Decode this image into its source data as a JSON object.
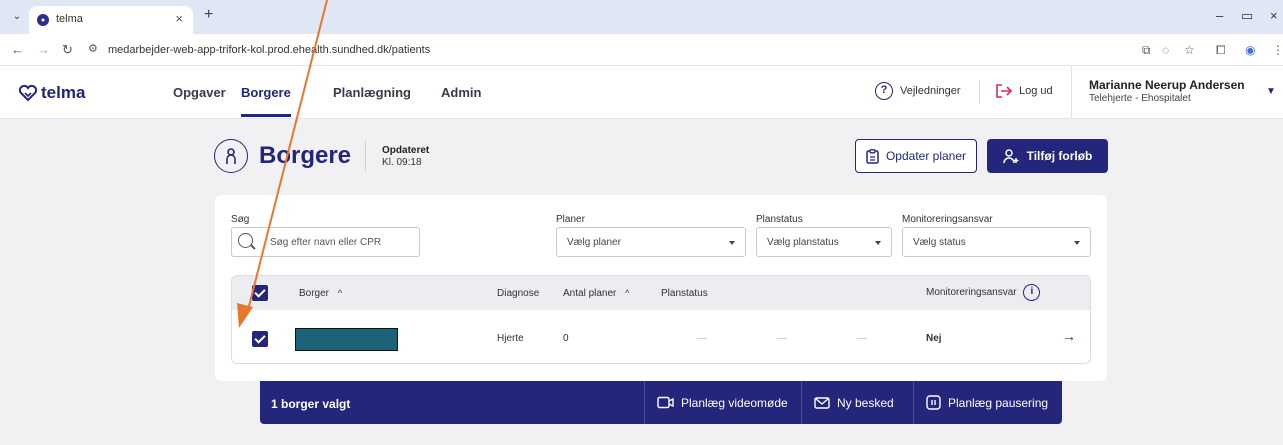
{
  "browser": {
    "tab_title": "telma",
    "tab_close": "×",
    "new_tab": "+",
    "url": "medarbejder-web-app-trifork-kol.prod.ehealth.sundhed.dk/patients",
    "minimize": "–",
    "restore": "▭",
    "close": "×"
  },
  "header": {
    "logo": "telma",
    "nav": [
      "Opgaver",
      "Borgere",
      "Planlægning",
      "Admin"
    ],
    "help": "Vejledninger",
    "logout": "Log ud",
    "user_name": "Marianne Neerup Andersen",
    "user_org": "Telehjerte - Ehospitalet"
  },
  "page": {
    "title": "Borgere",
    "updated_label": "Opdateret",
    "updated_time": "Kl. 09:18",
    "update_plans_button": "Opdater planer",
    "add_course_button": "Tilføj forløb"
  },
  "filters": {
    "search_label": "Søg",
    "search_placeholder": "Søg efter navn eller CPR",
    "plans_label": "Planer",
    "plans_value": "Vælg planer",
    "planstatus_label": "Planstatus",
    "planstatus_value": "Vælg planstatus",
    "monitor_label": "Monitoreringsansvar",
    "monitor_value": "Vælg status"
  },
  "table": {
    "columns": {
      "borger": "Borger",
      "diagnose": "Diagnose",
      "antal": "Antal planer",
      "planstatus": "Planstatus",
      "monitor": "Monitoreringsansvar",
      "sort_up": "^",
      "info": "i"
    },
    "rows": [
      {
        "diagnose": "Hjerte",
        "antal": "0",
        "dash1": "—",
        "dash2": "—",
        "dash3": "—",
        "monitor": "Nej",
        "checked": true
      }
    ]
  },
  "actionbar": {
    "selected": "1 borger valgt",
    "video": "Planlæg videomøde",
    "message": "Ny besked",
    "pause": "Planlæg pausering"
  },
  "colors": {
    "primary": "#23267a",
    "annotation": "#e8772e",
    "redaction": "#1c6378"
  }
}
